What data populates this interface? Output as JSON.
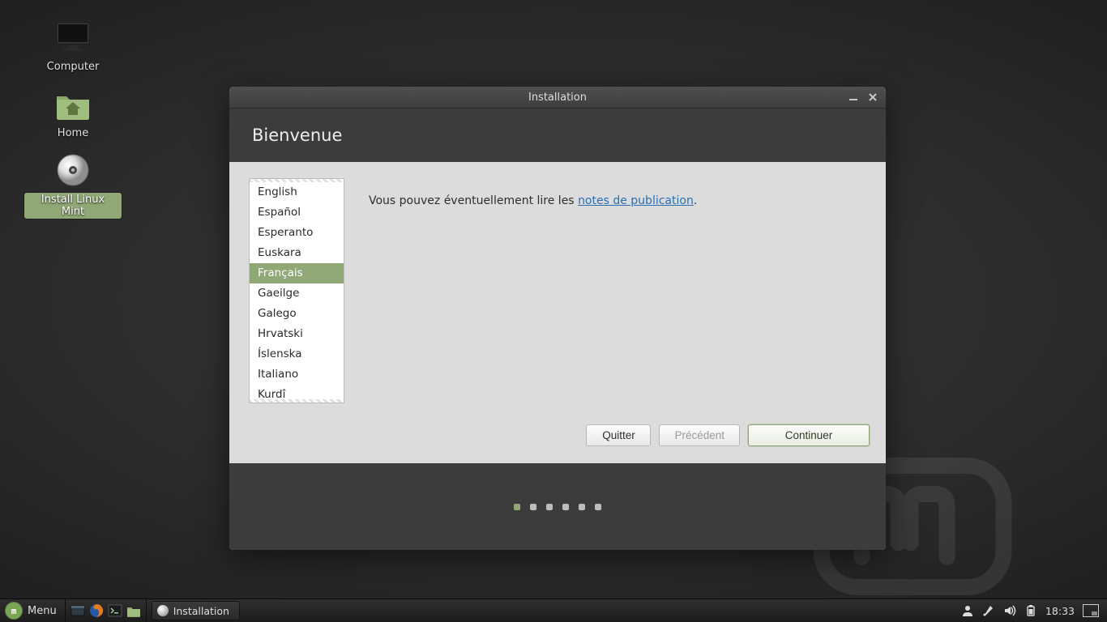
{
  "desktop_icons": {
    "computer": "Computer",
    "home": "Home",
    "install": "Install Linux Mint"
  },
  "window": {
    "title": "Installation",
    "header": "Bienvenue",
    "notes_prefix": "Vous pouvez éventuellement lire les ",
    "notes_link": "notes de publication",
    "buttons": {
      "quit": "Quitter",
      "back": "Précédent",
      "continue": "Continuer"
    },
    "languages": [
      "English",
      "Español",
      "Esperanto",
      "Euskara",
      "Français",
      "Gaeilge",
      "Galego",
      "Hrvatski",
      "Íslenska",
      "Italiano",
      "Kurdî"
    ],
    "selected_language_index": 4,
    "step_count": 6,
    "active_step": 0
  },
  "taskbar": {
    "menu_label": "Menu",
    "active_task": "Installation",
    "clock": "18:33"
  }
}
